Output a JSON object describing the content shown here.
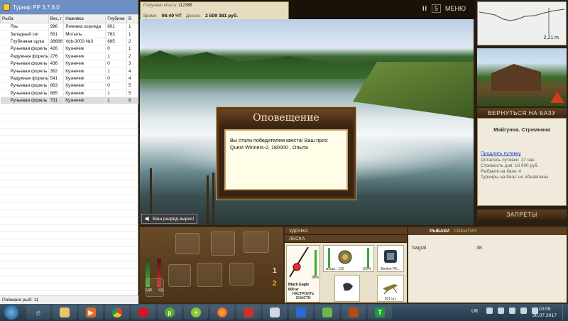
{
  "turnir": {
    "title": "Турнир РР 3.7.6.0",
    "columns": [
      "Рыба",
      "Вес, г",
      "Наживка",
      "Глубина",
      "В"
    ],
    "rows": [
      {
        "fish": "Язь",
        "weight": "996",
        "bait": "Личинка короеда",
        "depth": "801",
        "v": "1"
      },
      {
        "fish": "Западный сиг",
        "weight": "561",
        "bait": "Мотыль",
        "depth": "763",
        "v": "1"
      },
      {
        "fish": "Глубинная щука",
        "weight": "38688",
        "bait": "Vob-3003 №3",
        "depth": "685",
        "v": "2"
      },
      {
        "fish": "Ручьевая форель",
        "weight": "426",
        "bait": "Кузнечик",
        "depth": "0",
        "v": "1"
      },
      {
        "fish": "Радужная форель",
        "weight": "276",
        "bait": "Кузнечик",
        "depth": "1",
        "v": "2"
      },
      {
        "fish": "Ручьевая форель",
        "weight": "436",
        "bait": "Кузнечик",
        "depth": "0",
        "v": "3"
      },
      {
        "fish": "Ручьевая форель",
        "weight": "382",
        "bait": "Кузнечик",
        "depth": "1",
        "v": "4"
      },
      {
        "fish": "Радужная форель",
        "weight": "541",
        "bait": "Кузнечик",
        "depth": "0",
        "v": "4"
      },
      {
        "fish": "Ручьевая форель",
        "weight": "863",
        "bait": "Кузнечик",
        "depth": "0",
        "v": "5"
      },
      {
        "fish": "Ручьевая форель",
        "weight": "885",
        "bait": "Кузнечик",
        "depth": "1",
        "v": "5"
      },
      {
        "fish": "Ручьевая форель",
        "weight": "731",
        "bait": "Кузнечик",
        "depth": "1",
        "v": "6"
      }
    ],
    "status": "Поймано рыб: 11"
  },
  "top": {
    "experience_label": "Получено опыта:",
    "experience_value": "112385",
    "time_label": "Время:",
    "time_value": "06:40 ЧТ",
    "money_label": "Деньги:",
    "money_value": "2 509 381 руб.",
    "pause": "II",
    "slot": "5",
    "menu": "МЕНЮ"
  },
  "scene": {
    "toast": "Ваш разряд вырос!"
  },
  "notification": {
    "title": "Оповещение",
    "message": "Вы стали победителем квеста! Ваш приз: Quest Winners-2, 180000 , Опыта"
  },
  "sidebar": {
    "depth": "2,21 m",
    "return_label": "ВЕРНУТЬСЯ НА БАЗУ",
    "place": "Майгунна. Стремнина",
    "extend_trip": "Продлить путевку",
    "days_left": "Осталось путевки: 17 час.",
    "day_cost": "Стоимость дня: 16 000 руб.",
    "fishers_at_base": "Рыбаков на базе: 4",
    "tournaments": "Турниры на базе: не объявлены",
    "bans_label": "ЗАПРЕТЫ"
  },
  "tackle": {
    "rod_tab": "УДОЧКА",
    "line_tab": "ЛЕСКА",
    "rod_name": "Black Eagle",
    "rod_weight": "600 кг",
    "rod_percent": "98%",
    "setup_label": "НАСТРОИТЬ СНАСТИ",
    "reel_stat": "мощн.: 135",
    "reel_percent": "100%",
    "lure_name": "Benkei PE...",
    "bait_count": "301 шт."
  },
  "gear": {
    "meter_left": "ХДВ",
    "meter_right": "ХД",
    "slot1": "1",
    "slot2": "2"
  },
  "score": {
    "tab_fishers": "РЫБАКИ",
    "tab_events": "СОБЫТИЯ",
    "player": "bagrai",
    "points": "38"
  },
  "taskbar": {
    "lang": "UK",
    "time": "10:09",
    "date": "30.07.2017"
  },
  "colors": {
    "wood_dark": "#3c2813",
    "wood_header": "#5c3f22",
    "parchment": "#efeadb",
    "link": "#1c3ec8",
    "slot_two": "#f0b020",
    "taskbar": "#23384a"
  }
}
